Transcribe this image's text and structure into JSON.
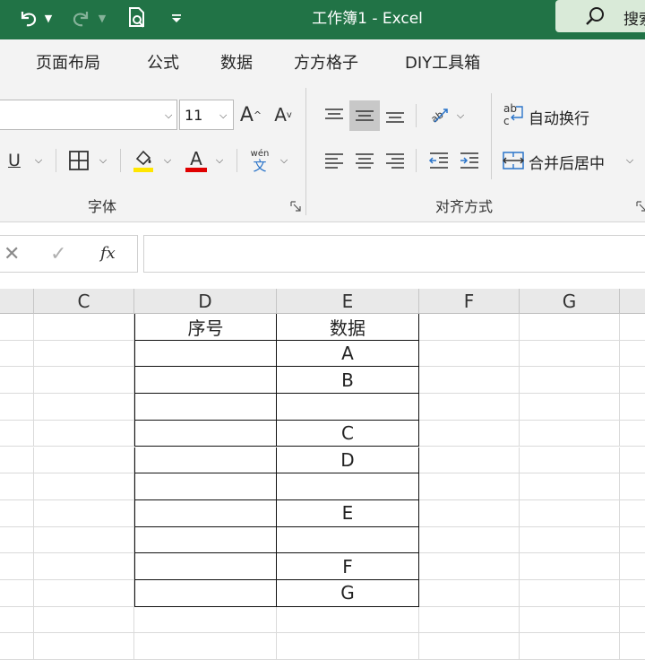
{
  "titlebar": {
    "title": "工作簿1  -  Excel",
    "search_label": "搜索",
    "undo_icon": "undo-icon",
    "redo_icon": "redo-icon",
    "print_preview_icon": "print-preview-icon",
    "customize_icon": "customize-qat-icon"
  },
  "tabs": [
    "页面布局",
    "公式",
    "数据",
    "方方格子",
    "DIY工具箱"
  ],
  "ribbon": {
    "font_name": "",
    "font_size": "11",
    "grow_font": "A",
    "shrink_font": "A",
    "underline": "U",
    "font_color_letter": "A",
    "phonetic_top": "wén",
    "phonetic_bottom": "文",
    "font_group_label": "字体",
    "wrap_text_label": "自动换行",
    "merge_center_label": "合并后居中",
    "align_group_label": "对齐方式",
    "fill_color": "#FFE600",
    "font_color": "#E00000",
    "accent": "#217346"
  },
  "formula_bar": {
    "cancel": "✕",
    "enter": "✓",
    "fx": "fx",
    "value": ""
  },
  "grid": {
    "columns": [
      "C",
      "D",
      "E",
      "F",
      "G"
    ],
    "table": [
      {
        "d": "序号",
        "e": "数据"
      },
      {
        "d": "",
        "e": "A"
      },
      {
        "d": "",
        "e": "B"
      },
      {
        "d": "",
        "e": ""
      },
      {
        "d": "",
        "e": "C"
      },
      {
        "d": "",
        "e": "D"
      },
      {
        "d": "",
        "e": ""
      },
      {
        "d": "",
        "e": "E"
      },
      {
        "d": "",
        "e": ""
      },
      {
        "d": "",
        "e": "F"
      },
      {
        "d": "",
        "e": "G"
      }
    ]
  }
}
